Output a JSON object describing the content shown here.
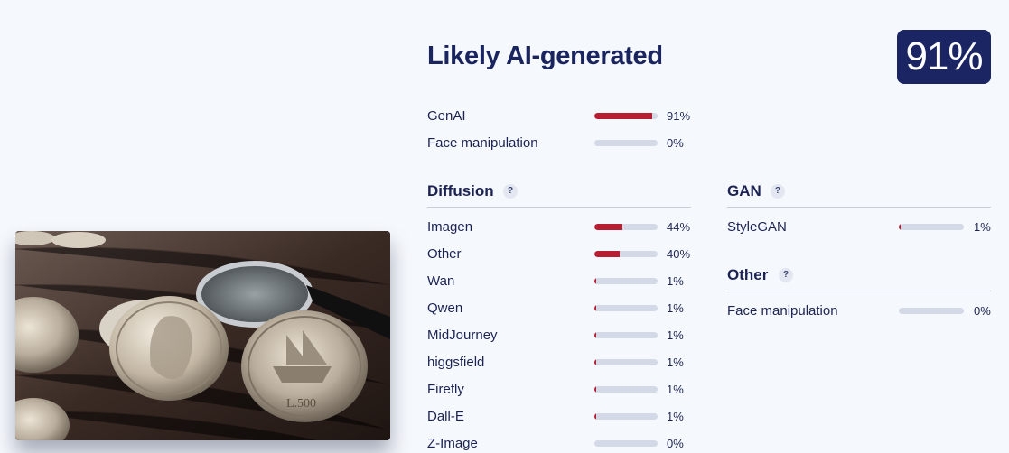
{
  "verdict": {
    "title": "Likely AI-generated",
    "score": "91%"
  },
  "summary": [
    {
      "label": "GenAI",
      "percent": "91%",
      "value": 0.91
    },
    {
      "label": "Face manipulation",
      "percent": "0%",
      "value": 0.0
    }
  ],
  "diffusion": {
    "title": "Diffusion",
    "help": "?",
    "items": [
      {
        "label": "Imagen",
        "percent": "44%",
        "value": 0.44
      },
      {
        "label": "Other",
        "percent": "40%",
        "value": 0.4
      },
      {
        "label": "Wan",
        "percent": "1%",
        "value": 0.01
      },
      {
        "label": "Qwen",
        "percent": "1%",
        "value": 0.01
      },
      {
        "label": "MidJourney",
        "percent": "1%",
        "value": 0.01
      },
      {
        "label": "higgsfield",
        "percent": "1%",
        "value": 0.01
      },
      {
        "label": "Firefly",
        "percent": "1%",
        "value": 0.01
      },
      {
        "label": "Dall-E",
        "percent": "1%",
        "value": 0.01
      },
      {
        "label": "Z-Image",
        "percent": "0%",
        "value": 0.0
      }
    ]
  },
  "gan": {
    "title": "GAN",
    "help": "?",
    "items": [
      {
        "label": "StyleGAN",
        "percent": "1%",
        "value": 0.01
      }
    ]
  },
  "other": {
    "title": "Other",
    "help": "?",
    "items": [
      {
        "label": "Face manipulation",
        "percent": "0%",
        "value": 0.0
      }
    ]
  },
  "colors": {
    "accent": "#b81e32",
    "badge": "#1b2563",
    "track": "#d3d9e6"
  }
}
